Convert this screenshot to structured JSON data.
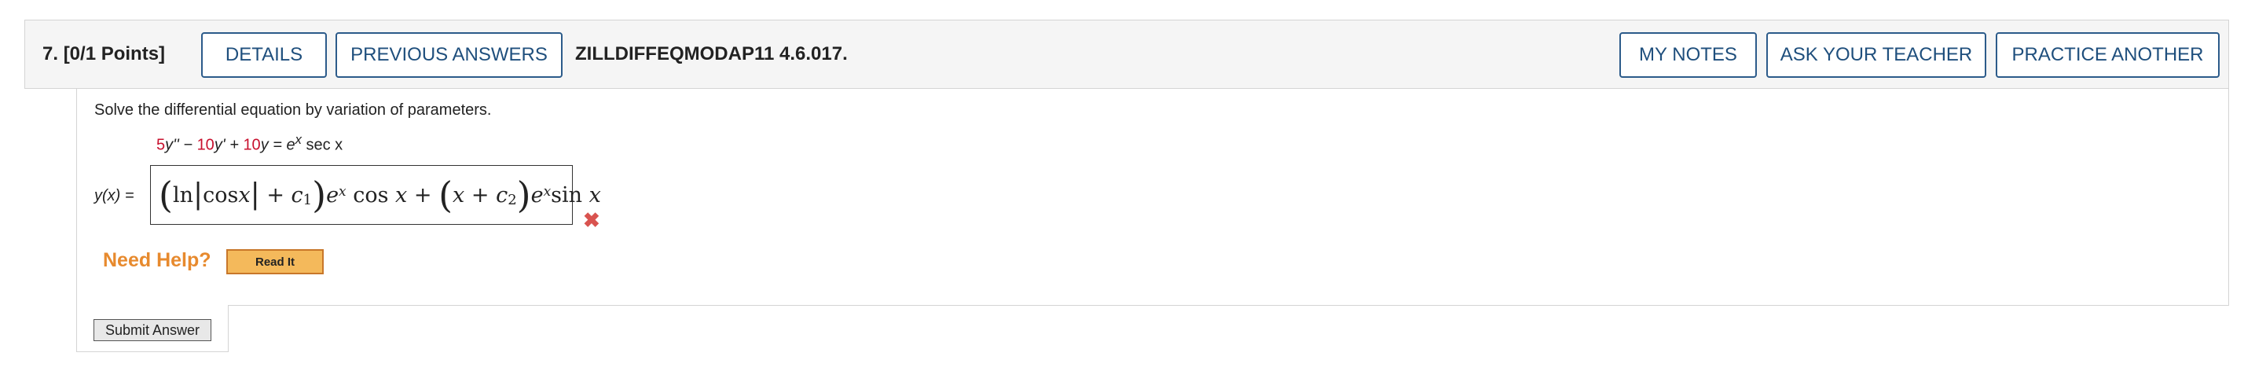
{
  "question": {
    "number_label": "7.",
    "points_label": "[0/1 Points]",
    "code": "ZILLDIFFEQMODAP11 4.6.017."
  },
  "header_buttons": {
    "details": "DETAILS",
    "previous_answers": "PREVIOUS ANSWERS",
    "my_notes": "MY NOTES",
    "ask_teacher": "ASK YOUR TEACHER",
    "practice_another": "PRACTICE ANOTHER"
  },
  "prompt": "Solve the differential equation by variation of parameters.",
  "equation": {
    "coef1": "5",
    "term1": "y'' − ",
    "coef2": "10",
    "term2": "y' + ",
    "coef3": "10",
    "term3": "y = ",
    "rhs_base": "e",
    "rhs_exp": "x",
    "rhs_rest": " sec x"
  },
  "answer": {
    "label": "y(x) =",
    "ln": "ln",
    "cos1": "cos",
    "x1": "x",
    "plus1": " + ",
    "c": "c",
    "sub1": "1",
    "e1": "e",
    "exp1": "x",
    "cos2": " cos ",
    "x2": "x",
    "plus2": " + ",
    "x3": "x",
    "plus3": " + ",
    "c2": "c",
    "sub2": "2",
    "e2": "e",
    "exp2": "x",
    "sin": "sin ",
    "x4": "x",
    "status": "incorrect",
    "status_color": "#d9534f"
  },
  "help": {
    "label": "Need Help?",
    "read_it": "Read It"
  },
  "submit_label": "Submit Answer",
  "colors": {
    "accent_blue": "#2c5b8a",
    "help_orange": "#e78a2e",
    "coef_red": "#c8102e"
  }
}
